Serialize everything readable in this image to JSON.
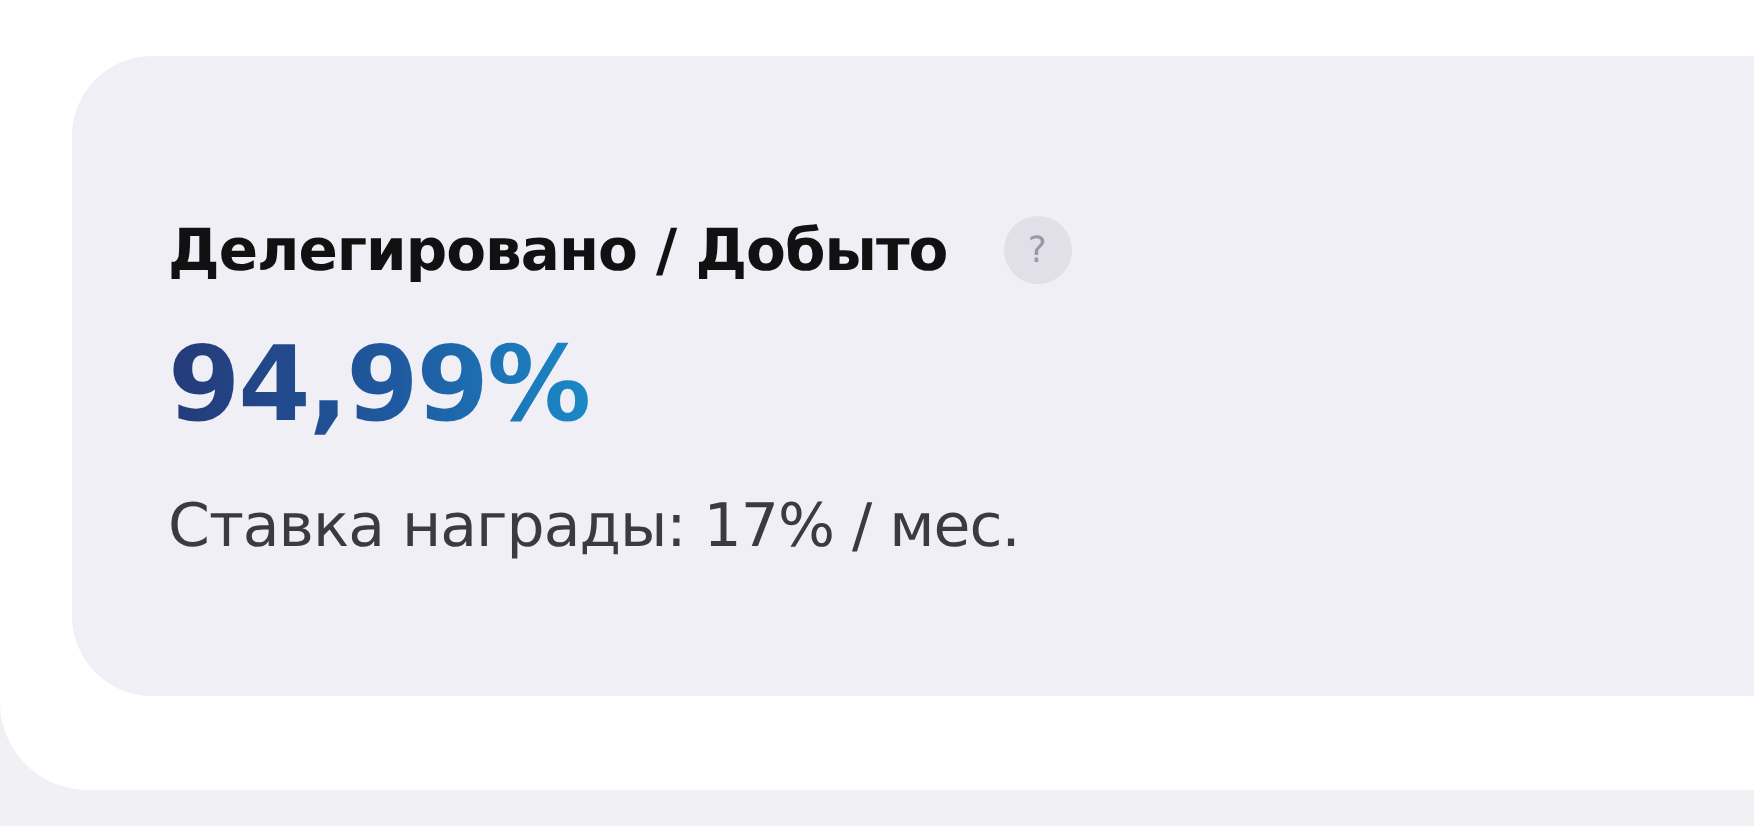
{
  "card": {
    "title": "Делегировано / Добыто",
    "help": "?",
    "value": "94,99%",
    "subtitle": "Ставка награды: 17% / мес."
  }
}
